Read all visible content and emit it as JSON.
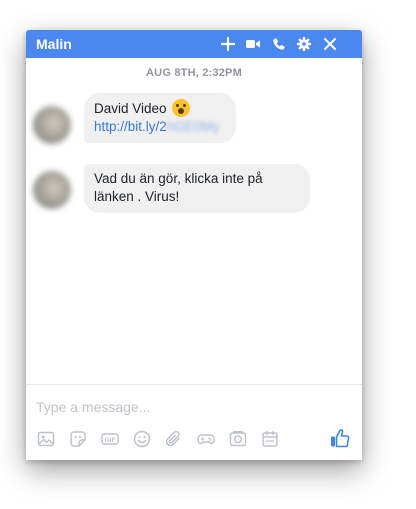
{
  "chat": {
    "title": "Malin",
    "header_icons": [
      "plus-icon",
      "video-camera-icon",
      "phone-icon",
      "gear-icon",
      "close-icon"
    ],
    "accent_color": "#4a88f0",
    "timestamp": "AUG 8TH, 2:32PM",
    "messages": [
      {
        "text": "David Video",
        "emoji": "surprised-face",
        "link_visible": "http://bit.ly/2",
        "link_obscured": "hGE0My"
      },
      {
        "text": "Vad du än gör, klicka inte på länken . Virus!"
      }
    ]
  },
  "composer": {
    "placeholder": "Type a message...",
    "tool_icons": [
      "image-icon",
      "sticker-icon",
      "gif-icon",
      "emoji-icon",
      "attachment-icon",
      "games-icon",
      "camera-icon",
      "calendar-icon",
      "thumbs-up-icon"
    ]
  }
}
